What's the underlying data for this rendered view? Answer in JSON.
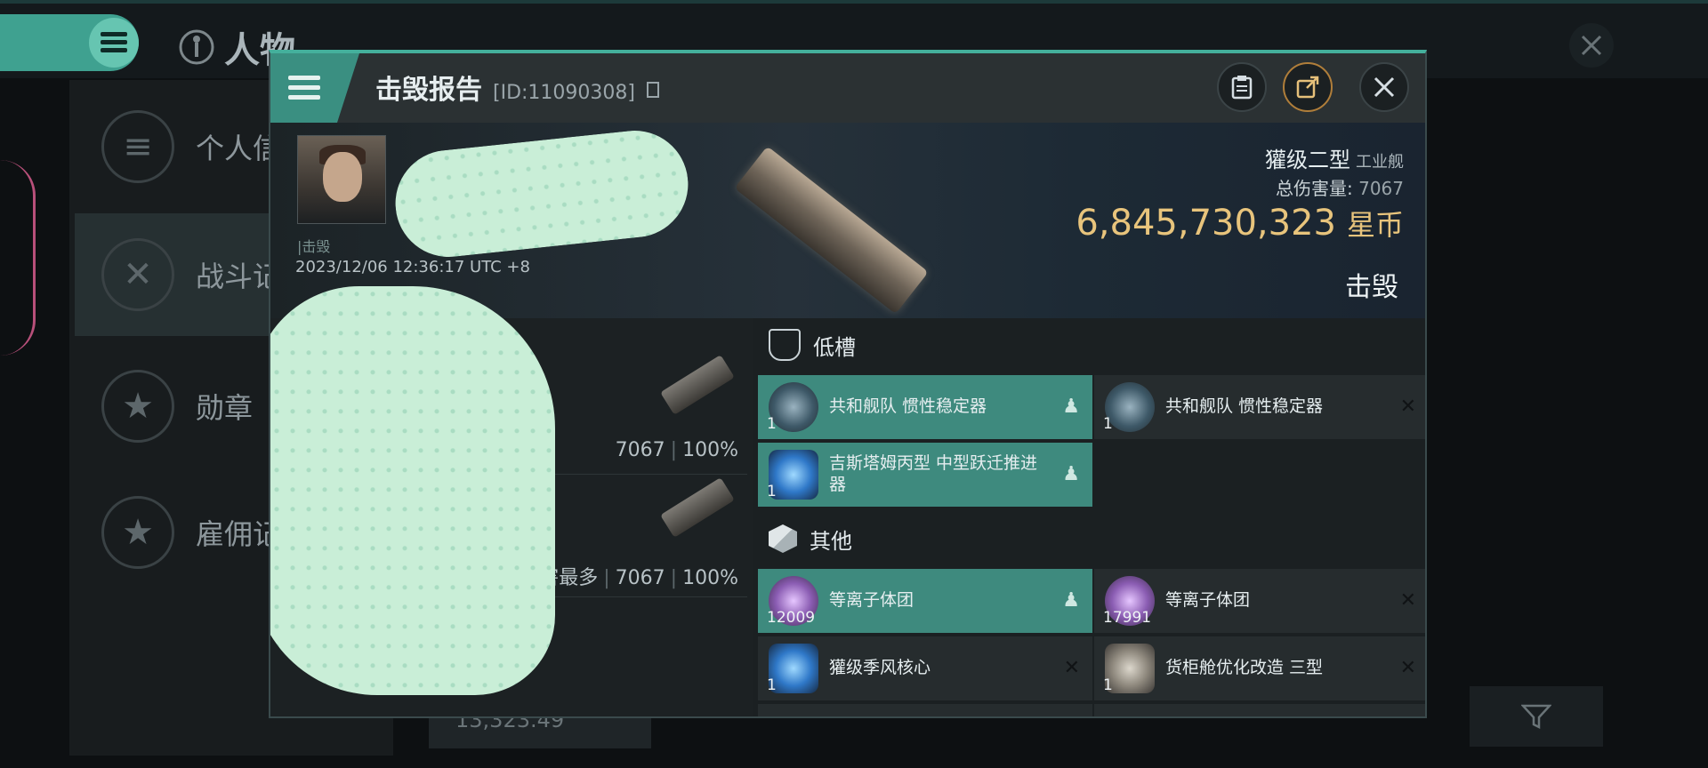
{
  "background": {
    "title": "人物",
    "side_items": [
      "个人信",
      "战斗记",
      "勋章",
      "雇佣记"
    ],
    "bottom_value": "13,323.49"
  },
  "modal": {
    "title": "击毁报告",
    "report_id": "[ID:11090308]",
    "victim": {
      "tag": "|击毁",
      "time": "2023/12/06 12:36:17 UTC +8"
    },
    "ship": {
      "name": "獾级二型",
      "class": "工业舰",
      "damage_label": "总伤害量:",
      "damage_value": "7067",
      "isk_value": "6,845,730,323",
      "isk_unit": "星币",
      "status": "击毁"
    },
    "attackers": [
      {
        "note": "",
        "damage": "7067",
        "percent": "100%"
      },
      {
        "note": "成伤害最多",
        "damage": "7067",
        "percent": "100%"
      }
    ],
    "sections": {
      "low": "低槽",
      "other": "其他"
    },
    "items": [
      {
        "name": "共和舰队 惯性稳定器",
        "qty": "1",
        "flag": "pilot"
      },
      {
        "name": "共和舰队 惯性稳定器",
        "qty": "1",
        "flag": "x"
      },
      {
        "name": "吉斯塔姆丙型 中型跃迁推进器",
        "qty": "1",
        "flag": "pilot"
      },
      {
        "name": "等离子体团",
        "qty": "12009",
        "flag": "pilot"
      },
      {
        "name": "等离子体团",
        "qty": "17991",
        "flag": "x"
      },
      {
        "name": "獾级季风核心",
        "qty": "1",
        "flag": "x"
      },
      {
        "name": "货柜舱优化改造 三型",
        "qty": "1",
        "flag": "x"
      }
    ],
    "colors": {
      "accent": "#3e8a7e",
      "isk": "#e8c47c"
    }
  }
}
